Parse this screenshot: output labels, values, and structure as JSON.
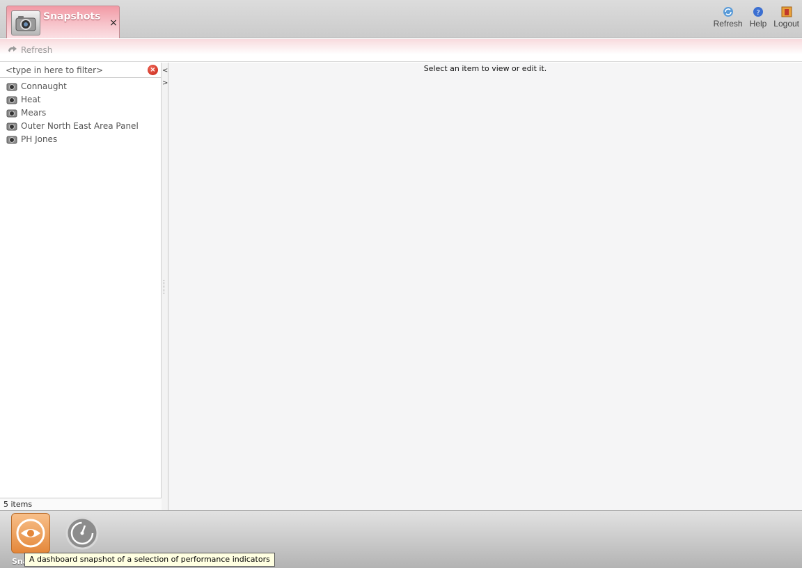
{
  "tab": {
    "label": "Snapshots",
    "close": "×",
    "icon": "camera-icon"
  },
  "top_actions": [
    {
      "label": "Refresh",
      "icon": "refresh-icon"
    },
    {
      "label": "Help",
      "icon": "help-icon"
    },
    {
      "label": "Logout",
      "icon": "logout-icon"
    }
  ],
  "toolbar": {
    "refresh_label": "Refresh",
    "refresh_icon": "refresh-arrow-icon"
  },
  "filter": {
    "placeholder": "<type in here to filter>",
    "clear_icon": "clear-filter-icon"
  },
  "list": {
    "items": [
      {
        "label": "Connaught"
      },
      {
        "label": "Heat"
      },
      {
        "label": "Mears"
      },
      {
        "label": "Outer North East Area Panel"
      },
      {
        "label": "PH Jones"
      }
    ],
    "count_text": "5 items"
  },
  "splitter": {
    "collapse": "<",
    "expand": ">"
  },
  "main": {
    "message": "Select an item to view or edit it."
  },
  "dock": {
    "active_label": "Sna",
    "tooltip": "A dashboard snapshot of a selection of performance indicators",
    "buttons": [
      {
        "icon": "eye-icon"
      },
      {
        "icon": "gauge-icon"
      }
    ]
  },
  "colors": {
    "tab_pink": "#f29aa5",
    "dock_orange": "#e4873a",
    "main_bg": "#f5f5f6"
  }
}
